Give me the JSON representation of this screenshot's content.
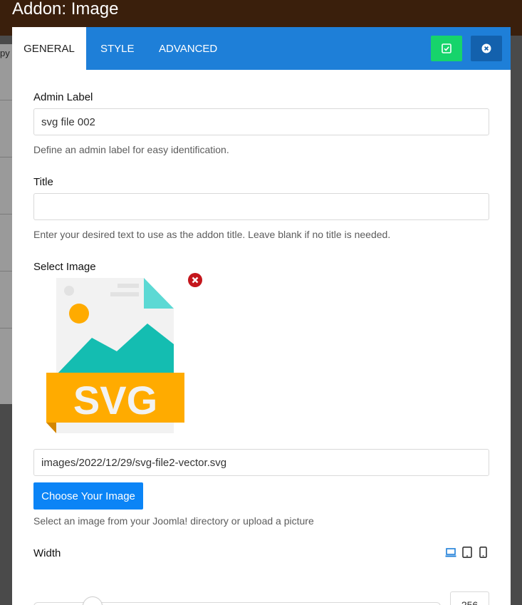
{
  "page": {
    "title": "Addon: Image",
    "backdrop_text": "py"
  },
  "tabs": [
    {
      "label": "GENERAL",
      "active": true
    },
    {
      "label": "STYLE",
      "active": false
    },
    {
      "label": "ADVANCED",
      "active": false
    }
  ],
  "header_buttons": {
    "save_icon": "check-square-icon",
    "close_icon": "close-circle-icon"
  },
  "colors": {
    "tabbar": "#1e7fd8",
    "save": "#16d46b",
    "close": "#1361ad",
    "primary": "#0b84f6",
    "remove": "#c4161c",
    "svg_orange": "#ffab00",
    "svg_teal": "#14bdb1"
  },
  "admin_label": {
    "label": "Admin Label",
    "value": "svg file 002",
    "help": "Define an admin label for easy identification."
  },
  "title_field": {
    "label": "Title",
    "value": "",
    "help": "Enter your desired text to use as the addon title. Leave blank if no title is needed."
  },
  "image": {
    "label": "Select Image",
    "preview_text": "SVG",
    "path": "images/2022/12/29/svg-file2-vector.svg",
    "choose_label": "Choose Your Image",
    "help": "Select an image from your Joomla! directory or upload a picture"
  },
  "width": {
    "label": "Width",
    "value": "256",
    "devices": [
      "desktop-icon",
      "tablet-icon",
      "mobile-icon"
    ],
    "active_device": "desktop"
  }
}
